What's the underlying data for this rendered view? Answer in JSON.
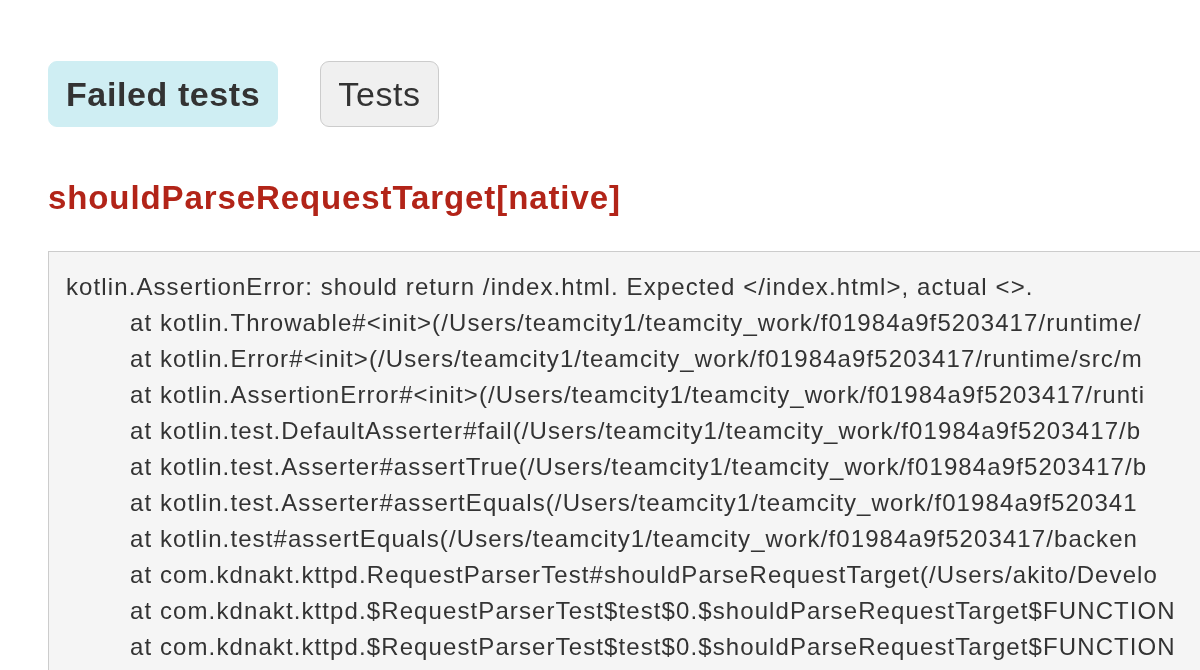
{
  "tabs": [
    {
      "label": "Failed tests",
      "selected": true
    },
    {
      "label": "Tests",
      "selected": false
    }
  ],
  "test_name": "shouldParseRequestTarget[native]",
  "stack_trace": {
    "message": "kotlin.AssertionError: should return /index.html. Expected </index.html>, actual <>.",
    "frames": [
      "at kotlin.Throwable#<init>(/Users/teamcity1/teamcity_work/f01984a9f5203417/runtime/",
      "at kotlin.Error#<init>(/Users/teamcity1/teamcity_work/f01984a9f5203417/runtime/src/m",
      "at kotlin.AssertionError#<init>(/Users/teamcity1/teamcity_work/f01984a9f5203417/runti",
      "at kotlin.test.DefaultAsserter#fail(/Users/teamcity1/teamcity_work/f01984a9f5203417/b",
      "at kotlin.test.Asserter#assertTrue(/Users/teamcity1/teamcity_work/f01984a9f5203417/b",
      "at kotlin.test.Asserter#assertEquals(/Users/teamcity1/teamcity_work/f01984a9f520341",
      "at kotlin.test#assertEquals(/Users/teamcity1/teamcity_work/f01984a9f5203417/backen",
      "at com.kdnakt.kttpd.RequestParserTest#shouldParseRequestTarget(/Users/akito/Develo",
      "at com.kdnakt.kttpd.$RequestParserTest$test$0.$shouldParseRequestTarget$FUNCTION",
      "at com.kdnakt.kttpd.$RequestParserTest$test$0.$shouldParseRequestTarget$FUNCTION"
    ]
  }
}
